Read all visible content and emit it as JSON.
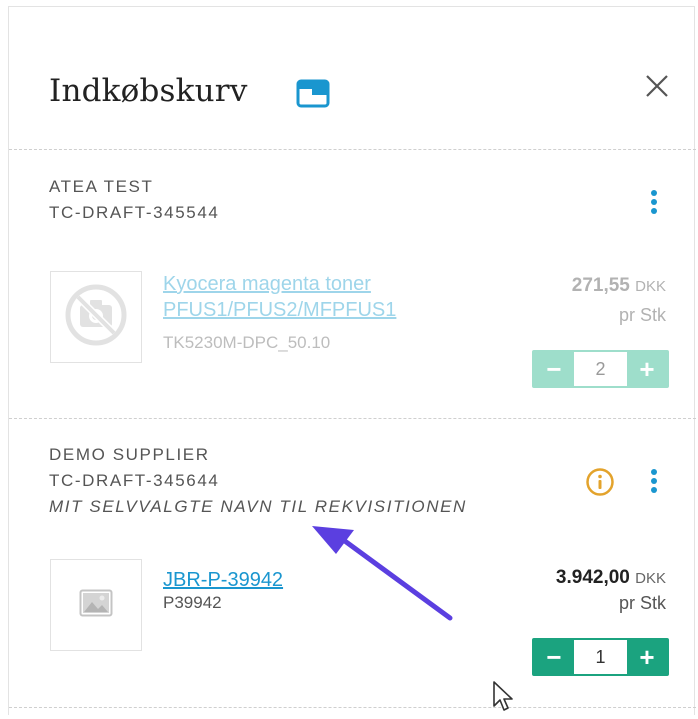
{
  "header": {
    "title": "Indkøbskurv"
  },
  "colors": {
    "accent_blue": "#1a96cf",
    "stepper_green": "#1ba37f",
    "stepper_green_disabled": "#9edecb",
    "info_orange": "#e3a32c",
    "arrow_purple": "#5b3fe0"
  },
  "groups": [
    {
      "supplier": "ATEA TEST",
      "draft_id": "TC-DRAFT-345544",
      "item": {
        "name": "Kyocera magenta toner PFUS1/PFUS2/MFPFUS1",
        "sku": "TK5230M-DPC_50.10",
        "price": "271,55",
        "currency": "DKK",
        "unit": "pr Stk",
        "quantity": "2",
        "image_icon": "no-camera-icon"
      }
    },
    {
      "supplier": "DEMO SUPPLIER",
      "draft_id": "TC-DRAFT-345644",
      "requisition_name": "MIT SELVVALGTE NAVN TIL REKVISITIONEN",
      "item": {
        "name": "JBR-P-39942",
        "sku": "P39942",
        "price": "3.942,00",
        "currency": "DKK",
        "unit": "pr Stk",
        "quantity": "1",
        "image_icon": "image-placeholder-icon"
      }
    }
  ]
}
